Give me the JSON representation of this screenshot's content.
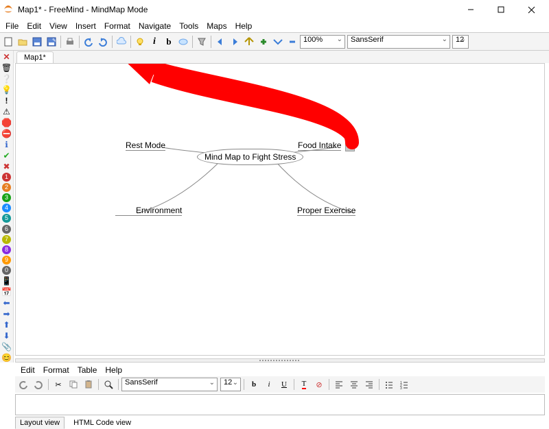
{
  "window": {
    "title": "Map1* - FreeMind - MindMap Mode"
  },
  "menu": {
    "items": [
      "File",
      "Edit",
      "View",
      "Insert",
      "Format",
      "Navigate",
      "Tools",
      "Maps",
      "Help"
    ]
  },
  "toolbar": {
    "zoom": "100%",
    "font": "SansSerif",
    "fontsize": "12"
  },
  "tabs": {
    "active": "Map1*"
  },
  "mindmap": {
    "root": "Mind Map to Fight Stress",
    "nodes": {
      "tl": "Rest Mode",
      "tr": "Food Intake",
      "bl": "Environment",
      "br": "Proper Exercise"
    }
  },
  "editor": {
    "menu": [
      "Edit",
      "Format",
      "Table",
      "Help"
    ],
    "font": "SansSerif",
    "fontsize": "12",
    "viewtabs": {
      "layout": "Layout view",
      "html": "HTML Code view"
    }
  }
}
